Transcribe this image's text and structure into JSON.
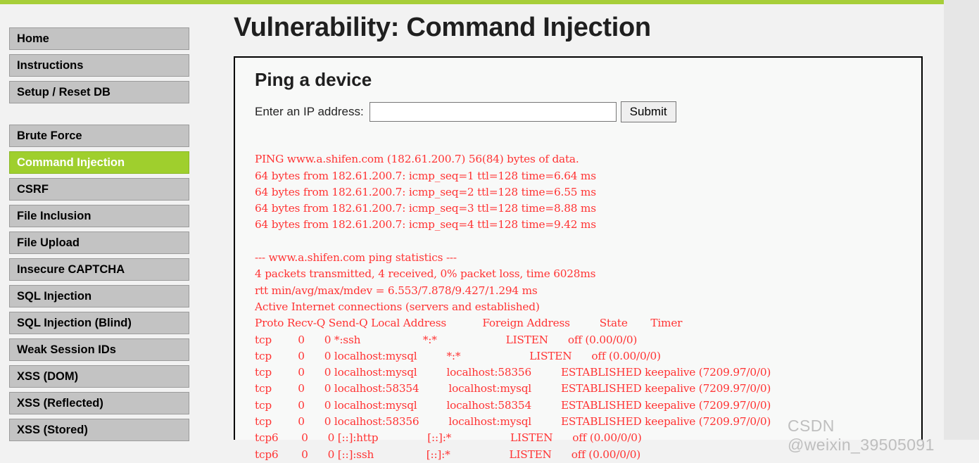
{
  "theme": {
    "accent_green": "#a7ce39",
    "active_nav_green": "#9fcf2d",
    "nav_grey": "#c3c3c3",
    "terminal_red": "#ff3333",
    "page_background": "#f2f2f2"
  },
  "sidebar": {
    "groups": [
      {
        "items": [
          {
            "label": "Home",
            "active": false
          },
          {
            "label": "Instructions",
            "active": false
          },
          {
            "label": "Setup / Reset DB",
            "active": false
          }
        ]
      },
      {
        "items": [
          {
            "label": "Brute Force",
            "active": false
          },
          {
            "label": "Command Injection",
            "active": true
          },
          {
            "label": "CSRF",
            "active": false
          },
          {
            "label": "File Inclusion",
            "active": false
          },
          {
            "label": "File Upload",
            "active": false
          },
          {
            "label": "Insecure CAPTCHA",
            "active": false
          },
          {
            "label": "SQL Injection",
            "active": false
          },
          {
            "label": "SQL Injection (Blind)",
            "active": false
          },
          {
            "label": "Weak Session IDs",
            "active": false
          },
          {
            "label": "XSS (DOM)",
            "active": false
          },
          {
            "label": "XSS (Reflected)",
            "active": false
          },
          {
            "label": "XSS (Stored)",
            "active": false
          }
        ]
      }
    ]
  },
  "main": {
    "page_title": "Vulnerability: Command Injection",
    "section_title": "Ping a device",
    "form": {
      "label": "Enter an IP address:",
      "input_value": "",
      "input_placeholder": "",
      "submit_label": "Submit"
    },
    "output_lines": [
      "PING www.a.shifen.com (182.61.200.7) 56(84) bytes of data.",
      "64 bytes from 182.61.200.7: icmp_seq=1 ttl=128 time=6.64 ms",
      "64 bytes from 182.61.200.7: icmp_seq=2 ttl=128 time=6.55 ms",
      "64 bytes from 182.61.200.7: icmp_seq=3 ttl=128 time=8.88 ms",
      "64 bytes from 182.61.200.7: icmp_seq=4 ttl=128 time=9.42 ms",
      "",
      "--- www.a.shifen.com ping statistics ---",
      "4 packets transmitted, 4 received, 0% packet loss, time 6028ms",
      "rtt min/avg/max/mdev = 6.553/7.878/9.427/1.294 ms",
      "Active Internet connections (servers and established)",
      "Proto Recv-Q Send-Q Local Address           Foreign Address         State       Timer",
      "tcp        0      0 *:ssh                   *:*                     LISTEN      off (0.00/0/0)",
      "tcp        0      0 localhost:mysql         *:*                     LISTEN      off (0.00/0/0)",
      "tcp        0      0 localhost:mysql         localhost:58356         ESTABLISHED keepalive (7209.97/0/0)",
      "tcp        0      0 localhost:58354         localhost:mysql         ESTABLISHED keepalive (7209.97/0/0)",
      "tcp        0      0 localhost:mysql         localhost:58354         ESTABLISHED keepalive (7209.97/0/0)",
      "tcp        0      0 localhost:58356         localhost:mysql         ESTABLISHED keepalive (7209.97/0/0)",
      "tcp6       0      0 [::]:http               [::]:*                  LISTEN      off (0.00/0/0)",
      "tcp6       0      0 [::]:ssh                [::]:*                  LISTEN      off (0.00/0/0)"
    ],
    "ping_summary": {
      "host": "www.a.shifen.com",
      "ip": "182.61.200.7",
      "packet_size": "56(84)",
      "packets_transmitted": 4,
      "packets_received": 4,
      "packet_loss": "0%",
      "total_time_ms": 6028,
      "rtt_min": 6.553,
      "rtt_avg": 7.878,
      "rtt_max": 9.427,
      "rtt_mdev": 1.294,
      "replies": [
        {
          "icmp_seq": 1,
          "ttl": 128,
          "time_ms": 6.64
        },
        {
          "icmp_seq": 2,
          "ttl": 128,
          "time_ms": 6.55
        },
        {
          "icmp_seq": 3,
          "ttl": 128,
          "time_ms": 8.88
        },
        {
          "icmp_seq": 4,
          "ttl": 128,
          "time_ms": 9.42
        }
      ]
    },
    "netstat": {
      "heading": "Active Internet connections (servers and established)",
      "columns": [
        "Proto",
        "Recv-Q",
        "Send-Q",
        "Local Address",
        "Foreign Address",
        "State",
        "Timer"
      ],
      "rows": [
        [
          "tcp",
          "0",
          "0",
          "*:ssh",
          "*:*",
          "LISTEN",
          "off (0.00/0/0)"
        ],
        [
          "tcp",
          "0",
          "0",
          "localhost:mysql",
          "*:*",
          "LISTEN",
          "off (0.00/0/0)"
        ],
        [
          "tcp",
          "0",
          "0",
          "localhost:mysql",
          "localhost:58356",
          "ESTABLISHED",
          "keepalive (7209.97/0/0)"
        ],
        [
          "tcp",
          "0",
          "0",
          "localhost:58354",
          "localhost:mysql",
          "ESTABLISHED",
          "keepalive (7209.97/0/0)"
        ],
        [
          "tcp",
          "0",
          "0",
          "localhost:mysql",
          "localhost:58354",
          "ESTABLISHED",
          "keepalive (7209.97/0/0)"
        ],
        [
          "tcp",
          "0",
          "0",
          "localhost:58356",
          "localhost:mysql",
          "ESTABLISHED",
          "keepalive (7209.97/0/0)"
        ],
        [
          "tcp6",
          "0",
          "0",
          "[::]:http",
          "[::]:*",
          "LISTEN",
          "off (0.00/0/0)"
        ],
        [
          "tcp6",
          "0",
          "0",
          "[::]:ssh",
          "[::]:*",
          "LISTEN",
          "off (0.00/0/0)"
        ]
      ]
    }
  },
  "watermark": {
    "text": "CSDN @weixin_39505091"
  }
}
